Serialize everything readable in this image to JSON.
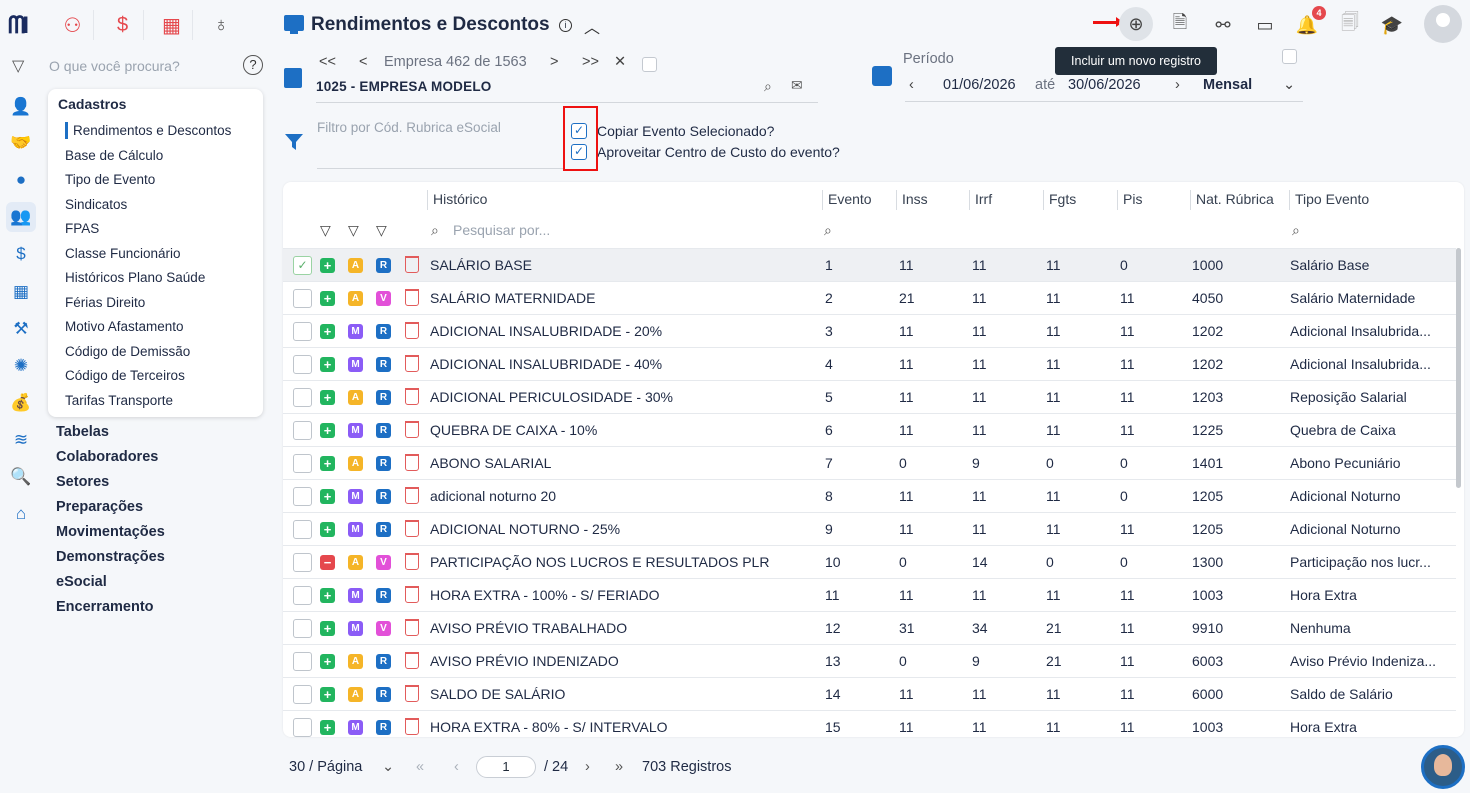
{
  "app": {
    "title": "Rendimentos e Descontos",
    "tooltip": "Incluir um novo registro",
    "notification_count": "4"
  },
  "sidebar": {
    "search_placeholder": "O que você procura?",
    "help": "?",
    "menu_title": "Cadastros",
    "menu_items": [
      "Rendimentos e Descontos",
      "Base de Cálculo",
      "Tipo de Evento",
      "Sindicatos",
      "FPAS",
      "Classe Funcionário",
      "Históricos Plano Saúde",
      "Férias Direito",
      "Motivo Afastamento",
      "Código de Demissão",
      "Código de Terceiros",
      "Tarifas Transporte"
    ],
    "sections": [
      "Tabelas",
      "Colaboradores",
      "Setores",
      "Preparações",
      "Movimentações",
      "Demonstrações",
      "eSocial",
      "Encerramento"
    ]
  },
  "company_nav": {
    "first": "<<",
    "prev": "<",
    "label": "Empresa 462 de 1563",
    "next": ">",
    "last": ">>",
    "close": "✕",
    "company": "1025 - EMPRESA MODELO"
  },
  "filter": {
    "placeholder": "Filtro por Cód. Rubrica eSocial",
    "copy_event_label": "Copiar Evento Selecionado?",
    "cost_center_label": "Aproveitar Centro de Custo do evento?"
  },
  "period": {
    "label": "Período",
    "start": "01/06/2026",
    "sep": "até",
    "end": "30/06/2026",
    "mode": "Mensal"
  },
  "table": {
    "columns": [
      "Histórico",
      "Evento",
      "Inss",
      "Irrf",
      "Fgts",
      "Pis",
      "Nat. Rúbrica",
      "Tipo Evento"
    ],
    "search_placeholder": "Pesquisar por...",
    "rows": [
      {
        "sign": "+",
        "a": "A",
        "b": "R",
        "hist": "SALÁRIO BASE",
        "ev": "1",
        "inss": "11",
        "irrf": "11",
        "fgts": "11",
        "pis": "0",
        "nat": "1000",
        "tipo": "Salário Base",
        "checked": true
      },
      {
        "sign": "+",
        "a": "A",
        "b": "V",
        "hist": "SALÁRIO MATERNIDADE",
        "ev": "2",
        "inss": "21",
        "irrf": "11",
        "fgts": "11",
        "pis": "11",
        "nat": "4050",
        "tipo": "Salário Maternidade"
      },
      {
        "sign": "+",
        "a": "M",
        "b": "R",
        "hist": "ADICIONAL INSALUBRIDADE - 20%",
        "ev": "3",
        "inss": "11",
        "irrf": "11",
        "fgts": "11",
        "pis": "11",
        "nat": "1202",
        "tipo": "Adicional Insalubrida..."
      },
      {
        "sign": "+",
        "a": "M",
        "b": "R",
        "hist": "ADICIONAL INSALUBRIDADE - 40%",
        "ev": "4",
        "inss": "11",
        "irrf": "11",
        "fgts": "11",
        "pis": "11",
        "nat": "1202",
        "tipo": "Adicional Insalubrida..."
      },
      {
        "sign": "+",
        "a": "A",
        "b": "R",
        "hist": "ADICIONAL PERICULOSIDADE - 30%",
        "ev": "5",
        "inss": "11",
        "irrf": "11",
        "fgts": "11",
        "pis": "11",
        "nat": "1203",
        "tipo": "Reposição Salarial"
      },
      {
        "sign": "+",
        "a": "M",
        "b": "R",
        "hist": "QUEBRA DE CAIXA - 10%",
        "ev": "6",
        "inss": "11",
        "irrf": "11",
        "fgts": "11",
        "pis": "11",
        "nat": "1225",
        "tipo": "Quebra de Caixa"
      },
      {
        "sign": "+",
        "a": "A",
        "b": "R",
        "hist": "ABONO SALARIAL",
        "ev": "7",
        "inss": "0",
        "irrf": "9",
        "fgts": "0",
        "pis": "0",
        "nat": "1401",
        "tipo": "Abono Pecuniário"
      },
      {
        "sign": "+",
        "a": "M",
        "b": "R",
        "hist": "adicional noturno 20",
        "ev": "8",
        "inss": "11",
        "irrf": "11",
        "fgts": "11",
        "pis": "0",
        "nat": "1205",
        "tipo": "Adicional Noturno"
      },
      {
        "sign": "+",
        "a": "M",
        "b": "R",
        "hist": "ADICIONAL NOTURNO - 25%",
        "ev": "9",
        "inss": "11",
        "irrf": "11",
        "fgts": "11",
        "pis": "11",
        "nat": "1205",
        "tipo": "Adicional Noturno"
      },
      {
        "sign": "-",
        "a": "A",
        "b": "V",
        "hist": "PARTICIPAÇÃO NOS LUCROS E RESULTADOS PLR",
        "ev": "10",
        "inss": "0",
        "irrf": "14",
        "fgts": "0",
        "pis": "0",
        "nat": "1300",
        "tipo": "Participação nos lucr..."
      },
      {
        "sign": "+",
        "a": "M",
        "b": "R",
        "hist": "HORA EXTRA - 100% - S/ FERIADO",
        "ev": "11",
        "inss": "11",
        "irrf": "11",
        "fgts": "11",
        "pis": "11",
        "nat": "1003",
        "tipo": "Hora Extra"
      },
      {
        "sign": "+",
        "a": "M",
        "b": "V",
        "hist": "AVISO PRÉVIO TRABALHADO",
        "ev": "12",
        "inss": "31",
        "irrf": "34",
        "fgts": "21",
        "pis": "11",
        "nat": "9910",
        "tipo": "Nenhuma"
      },
      {
        "sign": "+",
        "a": "A",
        "b": "R",
        "hist": "AVISO PRÉVIO INDENIZADO",
        "ev": "13",
        "inss": "0",
        "irrf": "9",
        "fgts": "21",
        "pis": "11",
        "nat": "6003",
        "tipo": "Aviso Prévio Indeniza..."
      },
      {
        "sign": "+",
        "a": "A",
        "b": "R",
        "hist": "SALDO DE SALÁRIO",
        "ev": "14",
        "inss": "11",
        "irrf": "11",
        "fgts": "11",
        "pis": "11",
        "nat": "6000",
        "tipo": "Saldo de Salário"
      },
      {
        "sign": "+",
        "a": "M",
        "b": "R",
        "hist": "HORA EXTRA - 80% - S/ INTERVALO",
        "ev": "15",
        "inss": "11",
        "irrf": "11",
        "fgts": "11",
        "pis": "11",
        "nat": "1003",
        "tipo": "Hora Extra"
      }
    ]
  },
  "pagination": {
    "page_size": "30 / Página",
    "current_page": "1",
    "total_pages": "/ 24",
    "records": "703 Registros"
  },
  "colors": {
    "accent": "#1d6fc4",
    "plus": "#22b55f",
    "minus": "#e5484d",
    "tag_a": "#f5b528",
    "tag_m": "#8b5cf6",
    "tag_v": "#e250d8",
    "tag_r": "#1d6fc4"
  }
}
